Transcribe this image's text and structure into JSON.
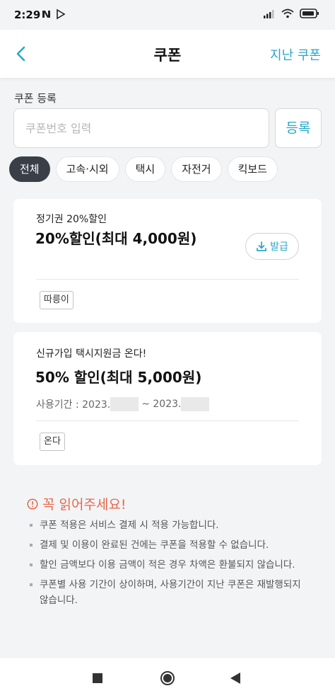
{
  "status_bar": {
    "time": "2:29"
  },
  "header": {
    "title": "쿠폰",
    "action_label": "지난 쿠폰"
  },
  "register": {
    "label": "쿠폰 등록",
    "placeholder": "쿠폰번호 입력",
    "button_label": "등록"
  },
  "filters": [
    {
      "label": "전체",
      "active": true
    },
    {
      "label": "고속·시외",
      "active": false
    },
    {
      "label": "택시",
      "active": false
    },
    {
      "label": "자전거",
      "active": false
    },
    {
      "label": "킥보드",
      "active": false
    }
  ],
  "coupons": [
    {
      "subtitle": "정기권 20%할인",
      "title": "20%할인(최대 4,000원)",
      "tag": "따릉이",
      "issue_label": "발급"
    },
    {
      "subtitle": "신규가입 택시지원금 온다!",
      "title": "50% 할인(최대 5,000원)",
      "period_prefix": "사용기간 : 2023.",
      "period_middle": "~ 2023.",
      "tag": "온다"
    }
  ],
  "notice": {
    "title": "꼭 읽어주세요!",
    "items": [
      "쿠폰 적용은 서비스 결제 시 적용 가능합니다.",
      "결제 및 이용이 완료된 건에는 쿠폰을 적용할 수 없습니다.",
      "할인 금액보다 이용 금액이 적은 경우 차액은 환불되지 않습니다.",
      "쿠폰별 사용 기간이 상이하며, 사용기간이 지난 쿠폰은 재발행되지 않습니다."
    ]
  },
  "colors": {
    "accent": "#2aa7c9",
    "notice": "#e8674a",
    "active_chip": "#3a3f47"
  },
  "icons": {
    "back": "chevron-left-icon",
    "download": "download-icon",
    "info": "info-circle-icon",
    "nav_recents": "square-icon",
    "nav_home": "circle-icon",
    "nav_back": "triangle-back-icon"
  }
}
